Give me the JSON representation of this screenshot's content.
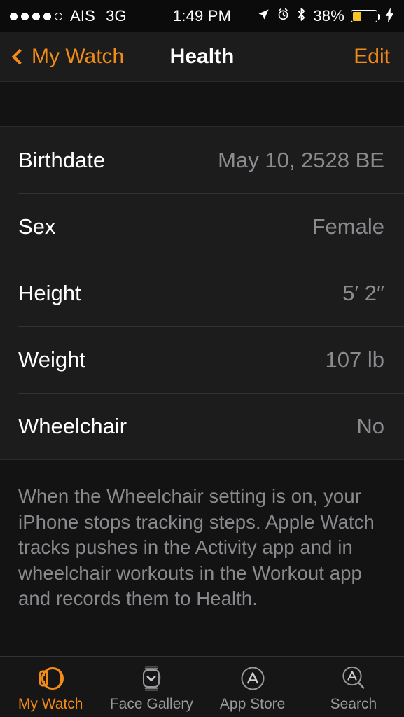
{
  "status_bar": {
    "signal_dots_filled": 4,
    "signal_dots_total": 5,
    "carrier": "AIS",
    "network": "3G",
    "time": "1:49 PM",
    "location_icon": "location-arrow-icon",
    "alarm_icon": "alarm-clock-icon",
    "bluetooth_icon": "bluetooth-icon",
    "battery_percent": "38%",
    "battery_level": 38,
    "battery_color": "#f7c325",
    "charging_icon": "lightning-bolt-icon"
  },
  "nav_bar": {
    "back_label": "My Watch",
    "back_icon": "chevron-left-icon",
    "title": "Health",
    "edit_label": "Edit",
    "accent_color": "#f28b18"
  },
  "settings": {
    "rows": [
      {
        "label": "Birthdate",
        "value": "May 10, 2528 BE"
      },
      {
        "label": "Sex",
        "value": "Female"
      },
      {
        "label": "Height",
        "value": "5′ 2″"
      },
      {
        "label": "Weight",
        "value": "107 lb"
      },
      {
        "label": "Wheelchair",
        "value": "No"
      }
    ],
    "footer_note": "When the Wheelchair setting is on, your iPhone stops tracking steps. Apple Watch tracks pushes in the Activity app and in wheelchair workouts in the Workout app and records them to Health."
  },
  "tab_bar": {
    "tabs": [
      {
        "label": "My Watch",
        "icon": "watch-side-icon",
        "active": true
      },
      {
        "label": "Face Gallery",
        "icon": "watch-face-icon",
        "active": false
      },
      {
        "label": "App Store",
        "icon": "app-store-icon",
        "active": false
      },
      {
        "label": "Search",
        "icon": "search-icon",
        "active": false
      }
    ]
  }
}
